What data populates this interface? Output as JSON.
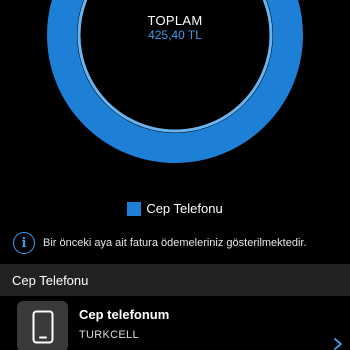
{
  "summary": {
    "total_label": "TOPLAM",
    "total_value": "425,40 TL"
  },
  "legend": {
    "label": "Cep Telefonu",
    "color": "#1d7fd6"
  },
  "info": {
    "message": "Bir önceki aya ait fatura ödemeleriniz gösterilmektedir."
  },
  "section": {
    "title": "Cep Telefonu"
  },
  "device": {
    "name": "Cep telefonum",
    "operator": "TURKCELL",
    "icon": "smartphone-icon"
  },
  "chart_data": {
    "type": "pie",
    "categories": [
      "Cep Telefonu"
    ],
    "values": [
      425.4
    ],
    "colors": [
      "#1d7fd6"
    ]
  },
  "colors": {
    "accent": "#1d7fd6",
    "accent_light": "#3d9ae8",
    "ring_highlight": "#6ab4f0",
    "background": "#000000",
    "header_bg": "#222224"
  }
}
